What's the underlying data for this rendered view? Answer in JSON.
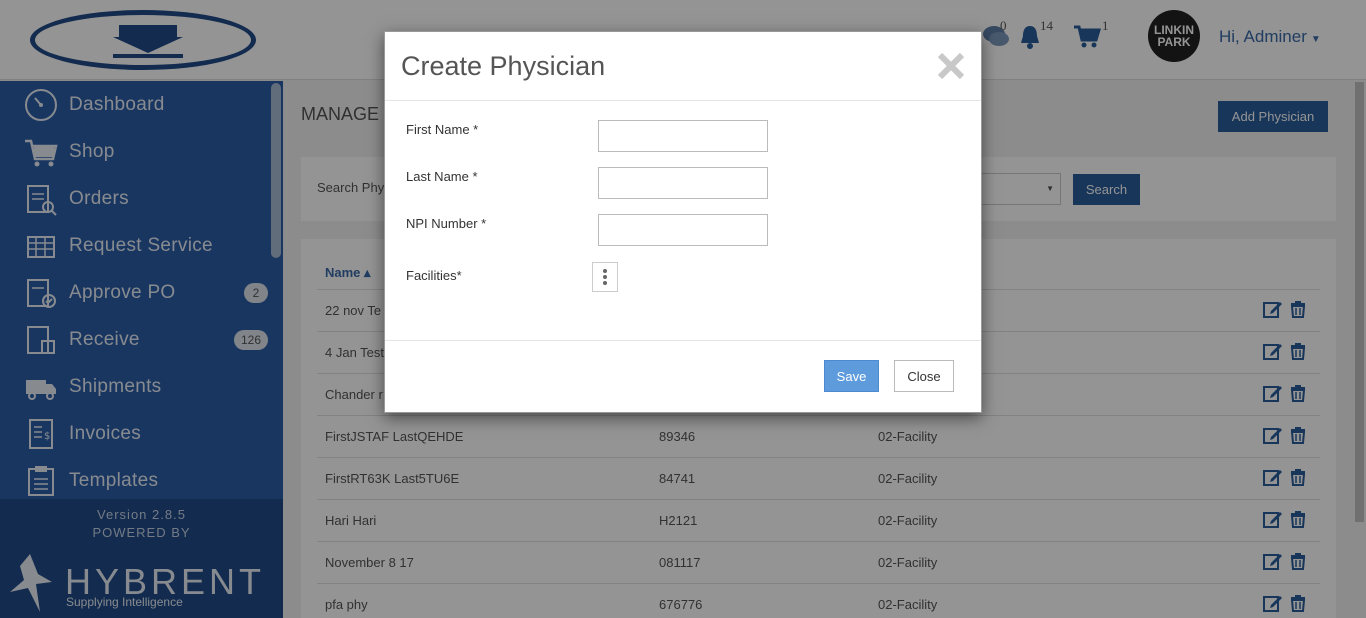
{
  "header": {
    "chat_count": "0",
    "notification_count": "14",
    "cart_count": "1",
    "avatar_text": "LINKIN PARK",
    "user_greeting": "Hi, Adminer"
  },
  "sidebar": {
    "items": [
      {
        "label": "Dashboard",
        "icon": "dashboard-icon",
        "badge": ""
      },
      {
        "label": "Shop",
        "icon": "cart-icon",
        "badge": ""
      },
      {
        "label": "Orders",
        "icon": "orders-icon",
        "badge": ""
      },
      {
        "label": "Request Service",
        "icon": "request-service-icon",
        "badge": ""
      },
      {
        "label": "Approve PO",
        "icon": "approve-po-icon",
        "badge": "2"
      },
      {
        "label": "Receive",
        "icon": "receive-icon",
        "badge": "126"
      },
      {
        "label": "Shipments",
        "icon": "truck-icon",
        "badge": ""
      },
      {
        "label": "Invoices",
        "icon": "invoice-icon",
        "badge": ""
      },
      {
        "label": "Templates",
        "icon": "template-icon",
        "badge": ""
      }
    ],
    "version": "Version 2.8.5",
    "powered_by": "POWERED BY",
    "brand": "HYBRENT",
    "tagline": "Supplying Intelligence"
  },
  "main": {
    "page_title": "MANAGE",
    "add_button": "Add Physician",
    "search_label": "Search Phy",
    "search_button": "Search",
    "table": {
      "name_header": "Name ▴",
      "rows": [
        {
          "name": "22 nov Te",
          "npi": "",
          "facility": ""
        },
        {
          "name": "4 Jan Test",
          "npi": "",
          "facility": ""
        },
        {
          "name": "Chander r",
          "npi": "",
          "facility": ""
        },
        {
          "name": "FirstJSTAF LastQEHDE",
          "npi": "89346",
          "facility": "02-Facility"
        },
        {
          "name": "FirstRT63K Last5TU6E",
          "npi": "84741",
          "facility": "02-Facility"
        },
        {
          "name": "Hari Hari",
          "npi": "H2121",
          "facility": "02-Facility"
        },
        {
          "name": "November 8 17",
          "npi": "081117",
          "facility": "02-Facility"
        },
        {
          "name": "pfa phy",
          "npi": "676776",
          "facility": "02-Facility"
        }
      ]
    }
  },
  "modal": {
    "title": "Create Physician",
    "first_name_label": "First Name *",
    "first_name_value": "",
    "last_name_label": "Last Name *",
    "last_name_value": "",
    "npi_label": "NPI Number *",
    "npi_value": "",
    "facilities_label": "Facilities*",
    "save_label": "Save",
    "close_label": "Close"
  }
}
